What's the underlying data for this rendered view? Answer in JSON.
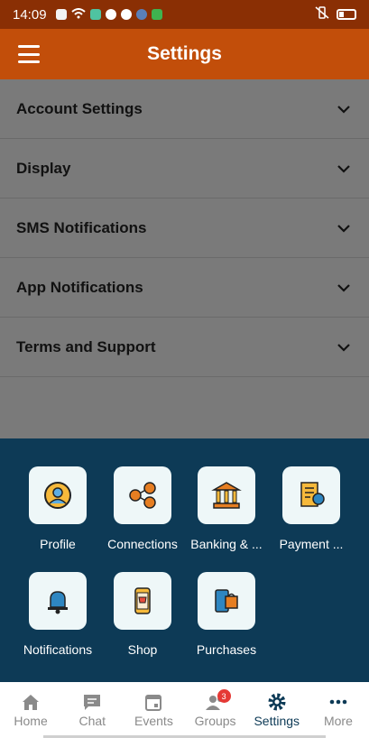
{
  "status_bar": {
    "time": "14:09"
  },
  "app_bar": {
    "title": "Settings"
  },
  "settings_sections": [
    {
      "label": "Account Settings"
    },
    {
      "label": "Display"
    },
    {
      "label": "SMS Notifications"
    },
    {
      "label": "App Notifications"
    },
    {
      "label": "Terms and Support"
    }
  ],
  "menu_tiles": [
    {
      "label": "Profile",
      "icon": "profile-icon"
    },
    {
      "label": "Connections",
      "icon": "connections-icon"
    },
    {
      "label": "Banking & ...",
      "icon": "bank-icon"
    },
    {
      "label": "Payment ...",
      "icon": "receipt-icon"
    },
    {
      "label": "Notifications",
      "icon": "bell-icon"
    },
    {
      "label": "Shop",
      "icon": "shop-cart-icon"
    },
    {
      "label": "Purchases",
      "icon": "purchases-icon"
    }
  ],
  "bottom_nav": {
    "items": [
      {
        "label": "Home",
        "icon": "home-icon"
      },
      {
        "label": "Chat",
        "icon": "chat-icon"
      },
      {
        "label": "Events",
        "icon": "calendar-icon"
      },
      {
        "label": "Groups",
        "icon": "groups-icon",
        "badge": "3"
      },
      {
        "label": "Settings",
        "icon": "gear-icon",
        "active": true
      },
      {
        "label": "More",
        "icon": "more-icon"
      }
    ]
  },
  "colors": {
    "status_bar": "#8a2f04",
    "app_bar": "#c24e0a",
    "overlay_list": "#7a7a7a",
    "sheet": "#0d3a56",
    "tile_bg": "#eef7f8",
    "badge": "#e53935",
    "nav_active": "#0d3a56"
  }
}
